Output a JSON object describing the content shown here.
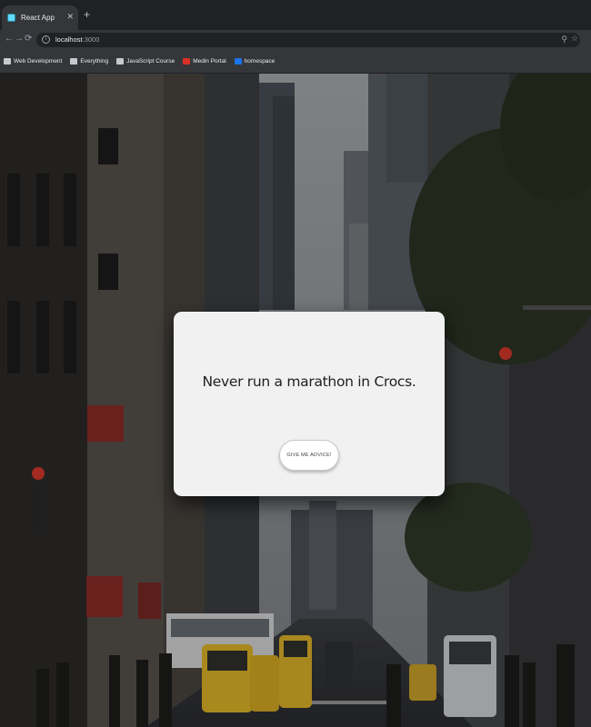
{
  "browser": {
    "tab": {
      "title": "React App"
    },
    "address_bar": {
      "host": "localhost",
      "port": ":3000"
    },
    "bookmarks": [
      {
        "label": "Web Development",
        "icon": "folder-icon"
      },
      {
        "label": "Everything",
        "icon": "folder-icon"
      },
      {
        "label": "JavaScript Course",
        "icon": "folder-icon"
      },
      {
        "label": "Medin Portal",
        "icon": "medin-icon"
      },
      {
        "label": "homespace",
        "icon": "homespace-icon"
      }
    ]
  },
  "page": {
    "background": "new-york-street-photo",
    "advice": {
      "text": "Never run a marathon in Crocs.",
      "button_label": "GIVE ME ADVICE!"
    }
  },
  "colors": {
    "card": "#f1f1f1",
    "chrome_dark": "#202124",
    "chrome": "#35363a",
    "accent": "#61dafb"
  }
}
